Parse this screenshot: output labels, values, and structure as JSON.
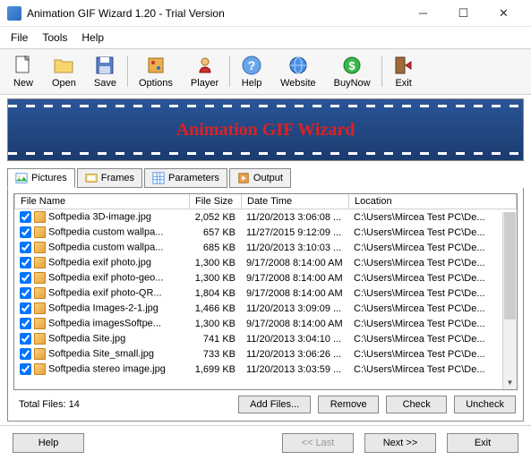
{
  "window": {
    "title": "Animation GIF Wizard 1.20 - Trial Version"
  },
  "menu": {
    "file": "File",
    "tools": "Tools",
    "help": "Help"
  },
  "toolbar": {
    "new": "New",
    "open": "Open",
    "save": "Save",
    "options": "Options",
    "player": "Player",
    "help": "Help",
    "website": "Website",
    "buynow": "BuyNow",
    "exit": "Exit"
  },
  "banner": {
    "text": "Animation GIF Wizard"
  },
  "tabs": {
    "pictures": "Pictures",
    "frames": "Frames",
    "parameters": "Parameters",
    "output": "Output"
  },
  "table": {
    "headers": {
      "name": "File Name",
      "size": "File Size",
      "date": "Date Time",
      "location": "Location"
    },
    "rows": [
      {
        "checked": true,
        "name": "Softpedia 3D-image.jpg",
        "size": "2,052 KB",
        "date": "11/20/2013 3:06:08 ...",
        "loc": "C:\\Users\\Mircea Test PC\\De..."
      },
      {
        "checked": true,
        "name": "Softpedia custom wallpa...",
        "size": "657 KB",
        "date": "11/27/2015 9:12:09 ...",
        "loc": "C:\\Users\\Mircea Test PC\\De..."
      },
      {
        "checked": true,
        "name": "Softpedia custom wallpa...",
        "size": "685 KB",
        "date": "11/20/2013 3:10:03 ...",
        "loc": "C:\\Users\\Mircea Test PC\\De..."
      },
      {
        "checked": true,
        "name": "Softpedia exif photo.jpg",
        "size": "1,300 KB",
        "date": "9/17/2008 8:14:00 AM",
        "loc": "C:\\Users\\Mircea Test PC\\De..."
      },
      {
        "checked": true,
        "name": "Softpedia exif photo-geo...",
        "size": "1,300 KB",
        "date": "9/17/2008 8:14:00 AM",
        "loc": "C:\\Users\\Mircea Test PC\\De..."
      },
      {
        "checked": true,
        "name": "Softpedia exif photo-QR...",
        "size": "1,804 KB",
        "date": "9/17/2008 8:14:00 AM",
        "loc": "C:\\Users\\Mircea Test PC\\De..."
      },
      {
        "checked": true,
        "name": "Softpedia Images-2-1.jpg",
        "size": "1,466 KB",
        "date": "11/20/2013 3:09:09 ...",
        "loc": "C:\\Users\\Mircea Test PC\\De..."
      },
      {
        "checked": true,
        "name": "Softpedia imagesSoftpe...",
        "size": "1,300 KB",
        "date": "9/17/2008 8:14:00 AM",
        "loc": "C:\\Users\\Mircea Test PC\\De..."
      },
      {
        "checked": true,
        "name": "Softpedia Site.jpg",
        "size": "741 KB",
        "date": "11/20/2013 3:04:10 ...",
        "loc": "C:\\Users\\Mircea Test PC\\De..."
      },
      {
        "checked": true,
        "name": "Softpedia Site_small.jpg",
        "size": "733 KB",
        "date": "11/20/2013 3:06:26 ...",
        "loc": "C:\\Users\\Mircea Test PC\\De..."
      },
      {
        "checked": true,
        "name": "Softpedia stereo image.jpg",
        "size": "1,699 KB",
        "date": "11/20/2013 3:03:59 ...",
        "loc": "C:\\Users\\Mircea Test PC\\De..."
      }
    ],
    "total_label": "Total Files: 14"
  },
  "buttons": {
    "add_files": "Add Files...",
    "remove": "Remove",
    "check": "Check",
    "uncheck": "Uncheck",
    "help": "Help",
    "last": "<< Last",
    "next": "Next >>",
    "exit": "Exit"
  }
}
